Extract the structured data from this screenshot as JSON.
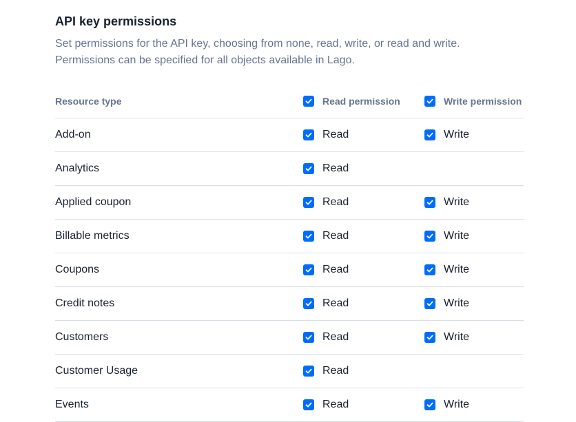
{
  "section": {
    "title": "API key permissions",
    "description_line1": "Set permissions for the API key, choosing from none, read, write, or read and write.",
    "description_line2": "Permissions can be specified for all objects available in Lago."
  },
  "table": {
    "headers": {
      "resource": "Resource type",
      "read": "Read permission",
      "write": "Write permission"
    },
    "header_read_checked": true,
    "header_write_checked": true,
    "read_label": "Read",
    "write_label": "Write",
    "rows": [
      {
        "name": "Add-on",
        "read": true,
        "write": true
      },
      {
        "name": "Analytics",
        "read": true,
        "write": null
      },
      {
        "name": "Applied coupon",
        "read": true,
        "write": true
      },
      {
        "name": "Billable metrics",
        "read": true,
        "write": true
      },
      {
        "name": "Coupons",
        "read": true,
        "write": true
      },
      {
        "name": "Credit notes",
        "read": true,
        "write": true
      },
      {
        "name": "Customers",
        "read": true,
        "write": true
      },
      {
        "name": "Customer Usage",
        "read": true,
        "write": null
      },
      {
        "name": "Events",
        "read": true,
        "write": true
      }
    ]
  },
  "colors": {
    "accent": "#006cfa",
    "text_primary": "#19212e",
    "text_secondary": "#66758f",
    "divider": "#d9dee7"
  },
  "icons": {
    "checkbox": "checkmark-icon"
  }
}
